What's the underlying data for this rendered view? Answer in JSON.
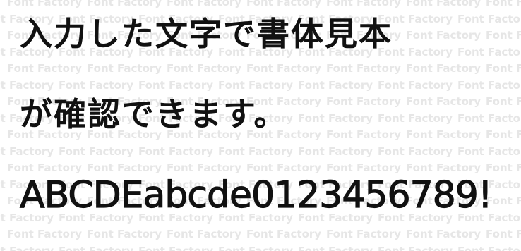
{
  "watermark": {
    "text": "Font Factory"
  },
  "sample": {
    "line1": "入力した文字で書体見本",
    "line2": "が確認できます。",
    "line3": "ABCDEabcde0123456789!"
  }
}
